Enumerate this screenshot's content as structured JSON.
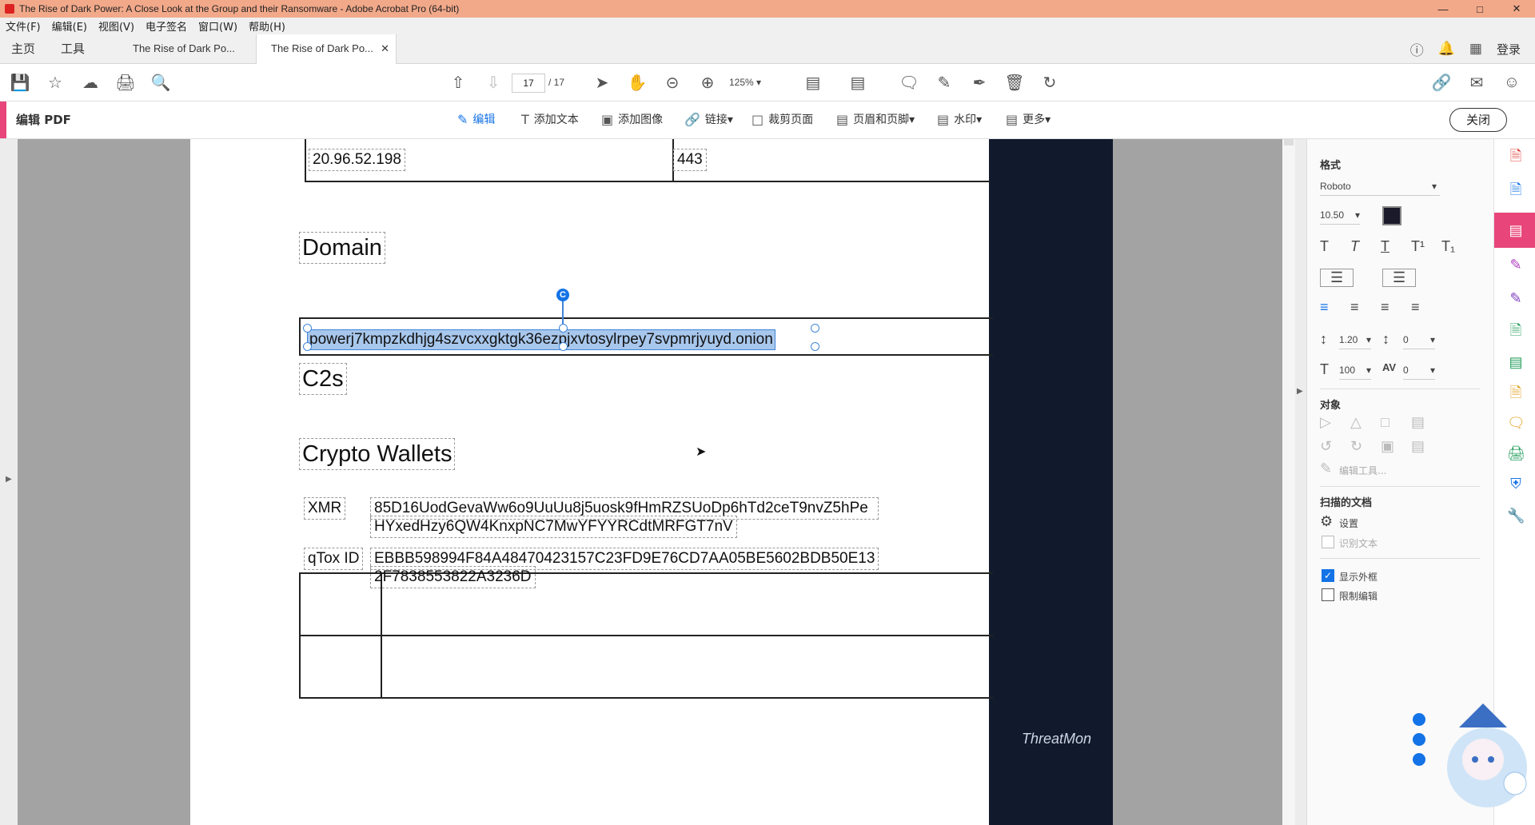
{
  "window": {
    "title": "The Rise of Dark Power: A Close Look at the Group and their Ransomware - Adobe Acrobat Pro (64-bit)",
    "controls": [
      "—",
      "□",
      "✕"
    ]
  },
  "menu": [
    "文件(F)",
    "编辑(E)",
    "视图(V)",
    "电子签名",
    "窗口(W)",
    "帮助(H)"
  ],
  "tabs": {
    "home": "主页",
    "tools": "工具",
    "doc1": "The Rise of Dark Po...",
    "doc2": "The Rise of Dark Po...",
    "close": "✕",
    "login": "登录"
  },
  "toolbar": {
    "page_current": "17",
    "page_total": "/ 17",
    "zoom": "125%"
  },
  "editbar": {
    "label": "编辑 PDF",
    "tools": [
      "编辑",
      "添加文本",
      "添加图像",
      "链接",
      "裁剪页面",
      "页眉和页脚",
      "水印",
      "更多"
    ],
    "close": "关闭"
  },
  "doc": {
    "ip": "20.96.52.198",
    "port": "443",
    "domain_heading": "Domain",
    "domain_value": "powerj7kmpzkdhjg4szvcxxgktgk36ezpjxvtosylrpey7svpmrjyuyd.onion",
    "c2_heading": "C2s",
    "wallets_heading": "Crypto Wallets",
    "xmr_label": "XMR",
    "xmr_line1": "85D16UodGevaWw6o9UuUu8j5uosk9fHmRZSUoDp6hTd2ceT9nvZ5hPe",
    "xmr_line2": "HYxedHzy6QW4KnxpNC7MwYFYYRCdtMRFGT7nV",
    "qtox_label": "qTox ID",
    "qtox_line1": "EBBB598994F84A48470423157C23FD9E76CD7AA05BE5602BDB50E13",
    "qtox_line2": "2F7838553822A3236D",
    "rotate_glyph": "C"
  },
  "rightpanel": {
    "format": "格式",
    "font": "Roboto",
    "size": "10.50",
    "line_spacing": "1.20",
    "para_spacing": "0",
    "scale": "100",
    "tracking": "0",
    "objects": "对象",
    "edit_tool": "编辑工具...",
    "scanned": "扫描的文档",
    "settings": "设置",
    "ocr": "识别文本",
    "show_bbox": "显示外框",
    "restrict": "限制编辑"
  },
  "watermark": "ThreatMon",
  "colors": {
    "title_bg": "#f2a98a",
    "accent_pink": "#e8457a",
    "accent_blue": "#1473e6",
    "dark_panel": "#101a2c"
  }
}
